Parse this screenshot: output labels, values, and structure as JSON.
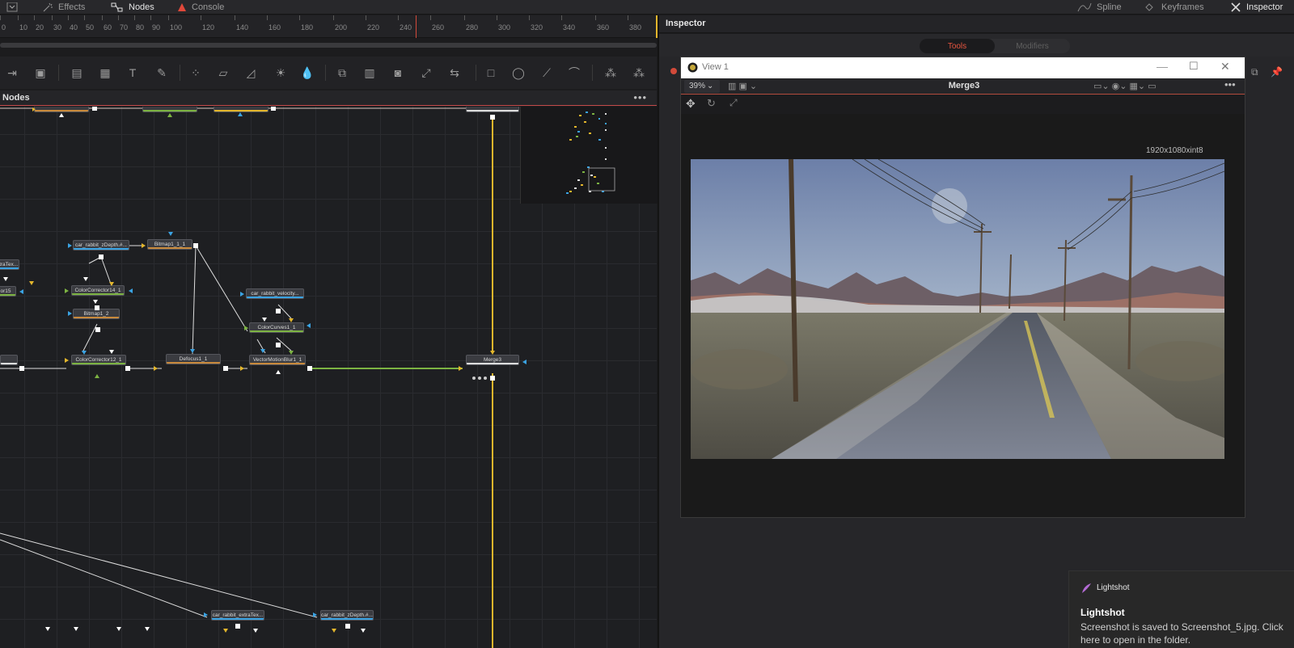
{
  "topbar": {
    "effects": "Effects",
    "nodes": "Nodes",
    "console": "Console",
    "spline": "Spline",
    "keyframes": "Keyframes",
    "inspector": "Inspector"
  },
  "ruler": {
    "ticks": [
      "0",
      "10",
      "20",
      "30",
      "40",
      "50",
      "60",
      "70",
      "80",
      "90",
      "100",
      "120",
      "140",
      "160",
      "180",
      "200",
      "220",
      "240",
      "260",
      "280",
      "300",
      "320",
      "340",
      "360",
      "380"
    ]
  },
  "nodes_panel": {
    "title": "Nodes",
    "menu": "•••",
    "node_labels": {
      "car_rabbit_zdepth": "car_rabbit_zDepth.#...",
      "bitmap1_1_1": "Bitmap1_1_1",
      "extratex_left": "xtraTex...",
      "or15": "or15",
      "colorcorrector14": "ColorCorrector14_1",
      "car_rabbit_velocity": "car_rabbit_velocity...",
      "bitmap1_2": "Bitmap1_2",
      "colorcurves1": "ColorCurves1_1",
      "colorcorrector12": "ColorCorrector12_1",
      "defocus1": "Defocus1_1",
      "vectormotionblur": "VectorMotionBlur1_1",
      "merge3": "Merge3",
      "car_rabbit_extratex": "car_rabbit_extraTex...",
      "car_rabbit_zdepth_bottom": "car_rabbit_zDepth.#..."
    }
  },
  "inspector": {
    "title": "Inspector",
    "tab_tools": "Tools",
    "tab_modifiers": "Modifiers"
  },
  "viewer_window": {
    "title": "View 1",
    "zoom": "39%",
    "node_name": "Merge3",
    "resolution": "1920x1080xint8"
  },
  "notification": {
    "app": "Lightshot",
    "heading": "Lightshot",
    "message": "Screenshot is saved to Screenshot_5.jpg. Click here to open in the folder."
  },
  "colors": {
    "accent_red": "#e8553f",
    "wire_yellow": "#e3b62c",
    "wire_green": "#7cb342",
    "input_blue": "#3aa3e3"
  }
}
